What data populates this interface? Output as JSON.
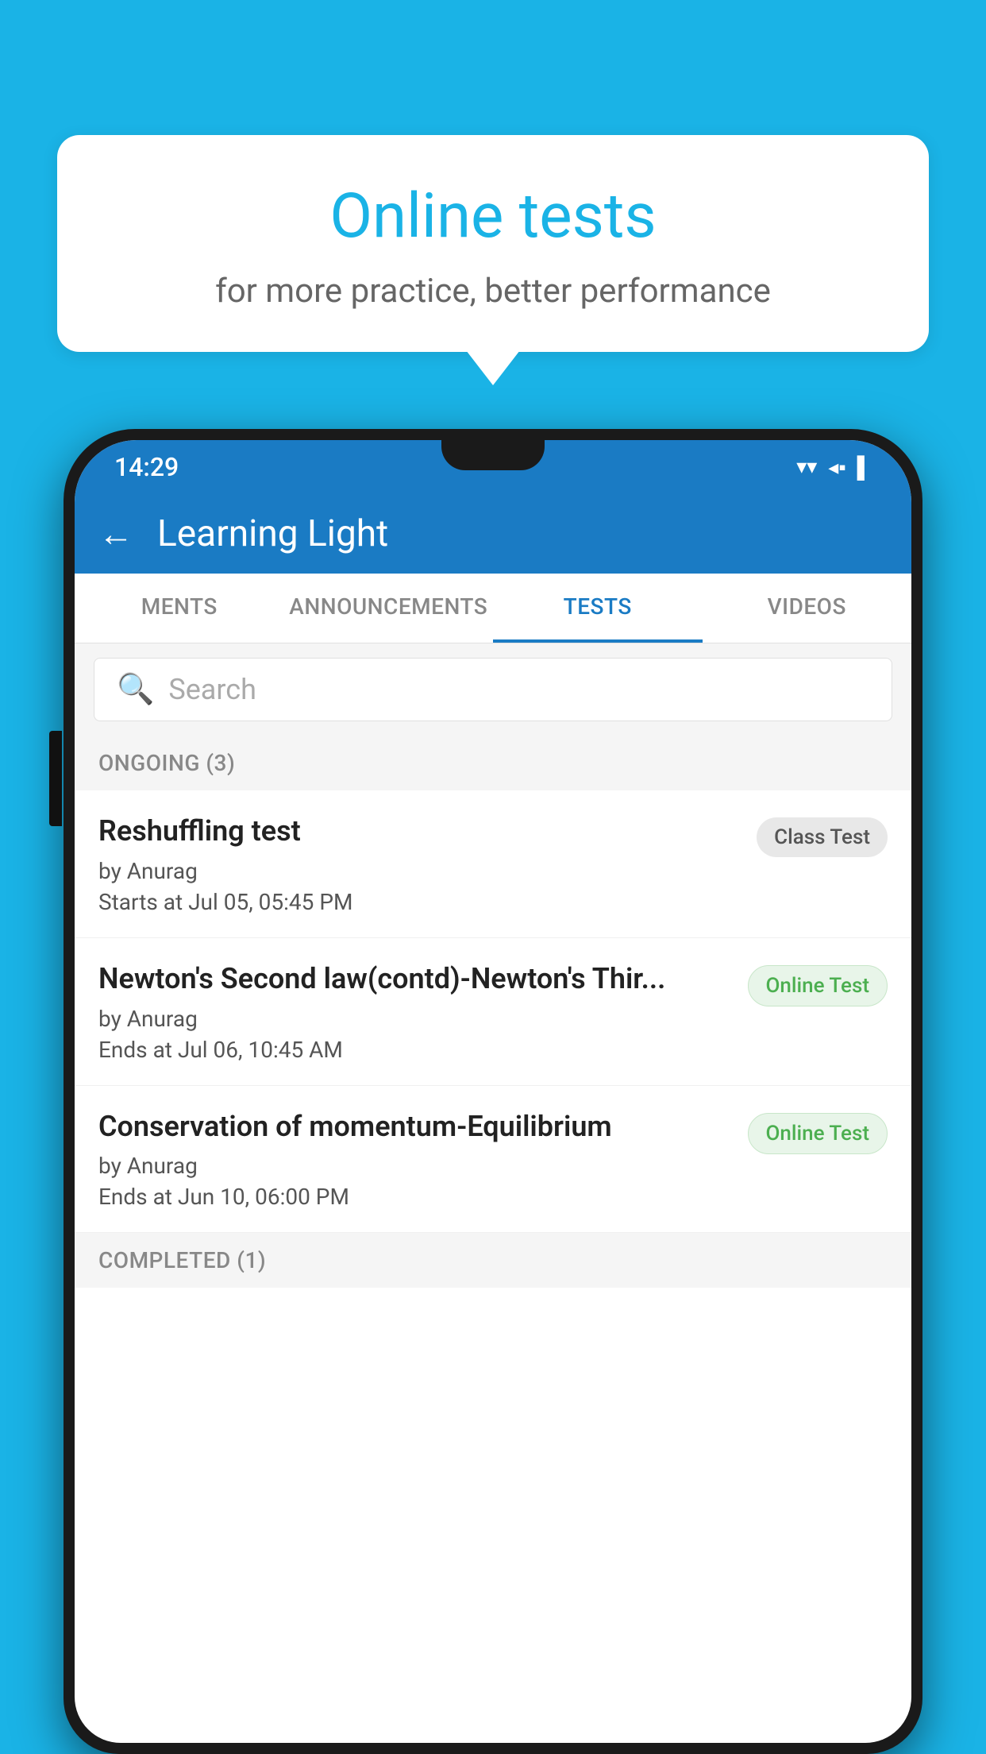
{
  "background_color": "#1ab3e6",
  "speech_bubble": {
    "title": "Online tests",
    "subtitle": "for more practice, better performance"
  },
  "phone": {
    "status_bar": {
      "time": "14:29",
      "icons": [
        "▼",
        "◀",
        "▌"
      ]
    },
    "header": {
      "back_label": "←",
      "title": "Learning Light"
    },
    "tabs": [
      {
        "label": "MENTS",
        "active": false
      },
      {
        "label": "ANNOUNCEMENTS",
        "active": false
      },
      {
        "label": "TESTS",
        "active": true
      },
      {
        "label": "VIDEOS",
        "active": false
      }
    ],
    "search": {
      "placeholder": "Search"
    },
    "ongoing_section": {
      "label": "ONGOING (3)"
    },
    "tests": [
      {
        "name": "Reshuffling test",
        "by": "by Anurag",
        "date": "Starts at  Jul 05, 05:45 PM",
        "badge": "Class Test",
        "badge_type": "class"
      },
      {
        "name": "Newton's Second law(contd)-Newton's Thir...",
        "by": "by Anurag",
        "date": "Ends at  Jul 06, 10:45 AM",
        "badge": "Online Test",
        "badge_type": "online"
      },
      {
        "name": "Conservation of momentum-Equilibrium",
        "by": "by Anurag",
        "date": "Ends at  Jun 10, 06:00 PM",
        "badge": "Online Test",
        "badge_type": "online"
      }
    ],
    "completed_section": {
      "label": "COMPLETED (1)"
    }
  }
}
